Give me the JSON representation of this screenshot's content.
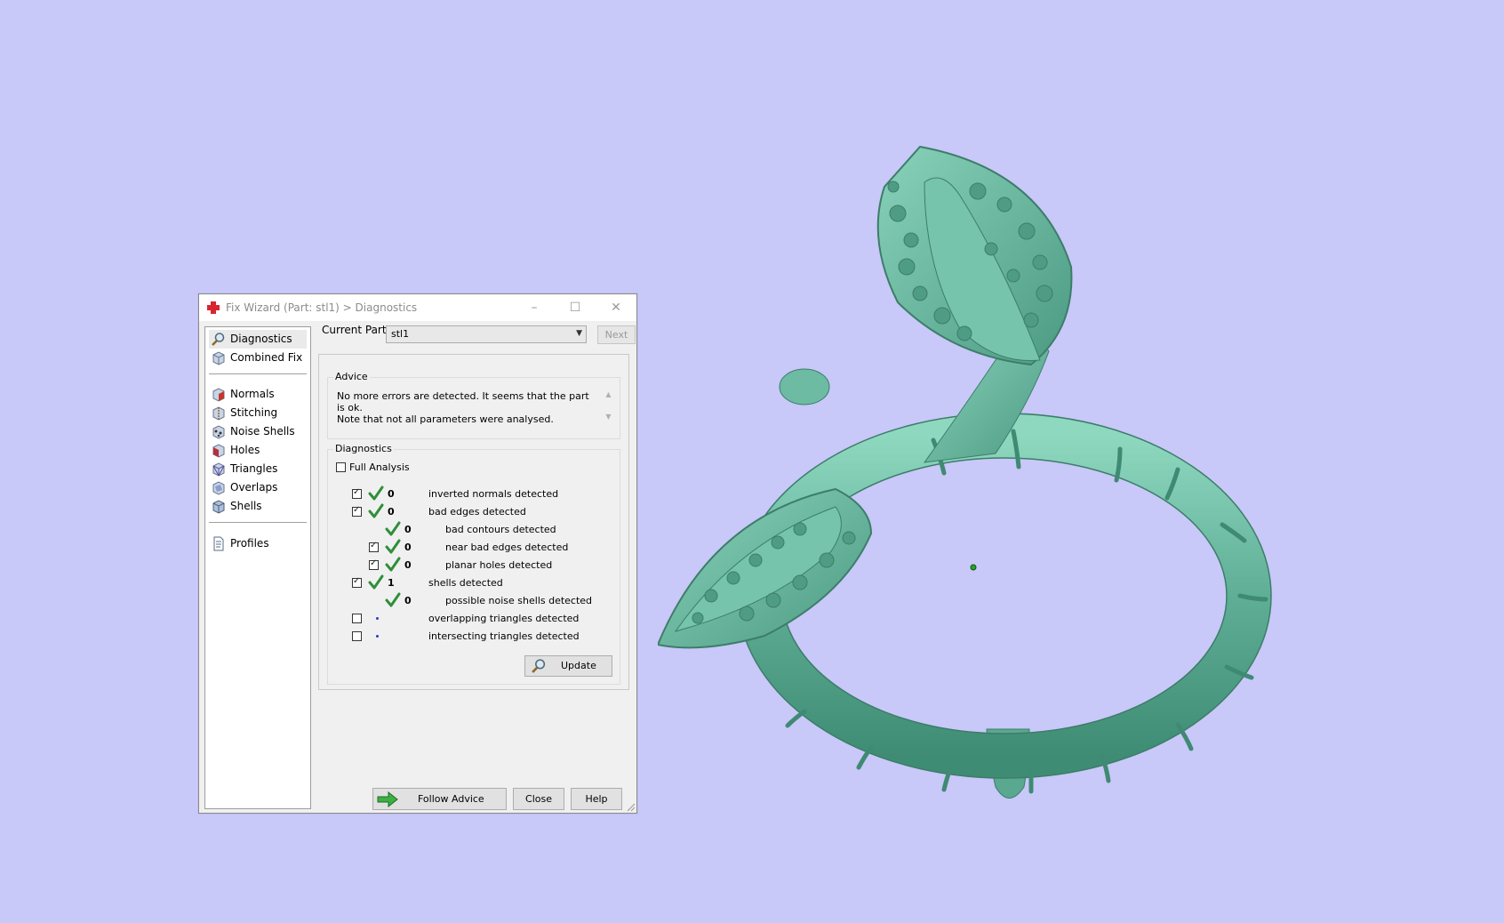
{
  "window": {
    "title": "Fix Wizard (Part: stl1) > Diagnostics"
  },
  "nav": {
    "top_items": [
      {
        "label": "Diagnostics",
        "icon": "magnifier-icon"
      },
      {
        "label": "Combined Fix",
        "icon": "combined-fix-icon"
      }
    ],
    "tool_items": [
      {
        "label": "Normals",
        "icon": "normals-icon"
      },
      {
        "label": "Stitching",
        "icon": "stitching-icon"
      },
      {
        "label": "Noise Shells",
        "icon": "noise-shells-icon"
      },
      {
        "label": "Holes",
        "icon": "holes-icon"
      },
      {
        "label": "Triangles",
        "icon": "triangles-icon"
      },
      {
        "label": "Overlaps",
        "icon": "overlaps-icon"
      },
      {
        "label": "Shells",
        "icon": "shells-icon"
      }
    ],
    "bottom_items": [
      {
        "label": "Profiles",
        "icon": "profiles-icon"
      }
    ]
  },
  "current_part": {
    "label": "Current Part:",
    "value": "stl1",
    "next_label": "Next"
  },
  "advice": {
    "title": "Advice",
    "line1": "No more errors are detected. It seems that the part is ok.",
    "line2": "Note that not all parameters were analysed."
  },
  "diagnostics": {
    "title": "Diagnostics",
    "full_analysis_label": "Full Analysis",
    "rows": [
      {
        "label": "inverted normals detected",
        "count": "0",
        "checkbox": true,
        "checked": true,
        "status": "ok"
      },
      {
        "label": "bad edges detected",
        "count": "0",
        "checkbox": true,
        "checked": true,
        "status": "ok"
      },
      {
        "label": "bad contours detected",
        "count": "0",
        "checkbox": false,
        "checked": false,
        "status": "ok"
      },
      {
        "label": "near bad edges detected",
        "count": "0",
        "checkbox": true,
        "checked": true,
        "status": "ok"
      },
      {
        "label": "planar holes detected",
        "count": "0",
        "checkbox": true,
        "checked": true,
        "status": "ok"
      },
      {
        "label": "shells detected",
        "count": "1",
        "checkbox": true,
        "checked": true,
        "status": "ok"
      },
      {
        "label": "possible noise shells detected",
        "count": "0",
        "checkbox": false,
        "checked": false,
        "status": "ok"
      },
      {
        "label": "overlapping triangles detected",
        "count": "",
        "checkbox": true,
        "checked": false,
        "status": "not-analysed"
      },
      {
        "label": "intersecting triangles detected",
        "count": "",
        "checkbox": true,
        "checked": false,
        "status": "not-analysed"
      }
    ],
    "update_label": "Update"
  },
  "buttons": {
    "follow_advice": "Follow Advice",
    "close": "Close",
    "help": "Help"
  },
  "colors": {
    "background": "#c8c8f9",
    "model": "#6fbfa6",
    "ok_tick": "#2f8f3a"
  }
}
